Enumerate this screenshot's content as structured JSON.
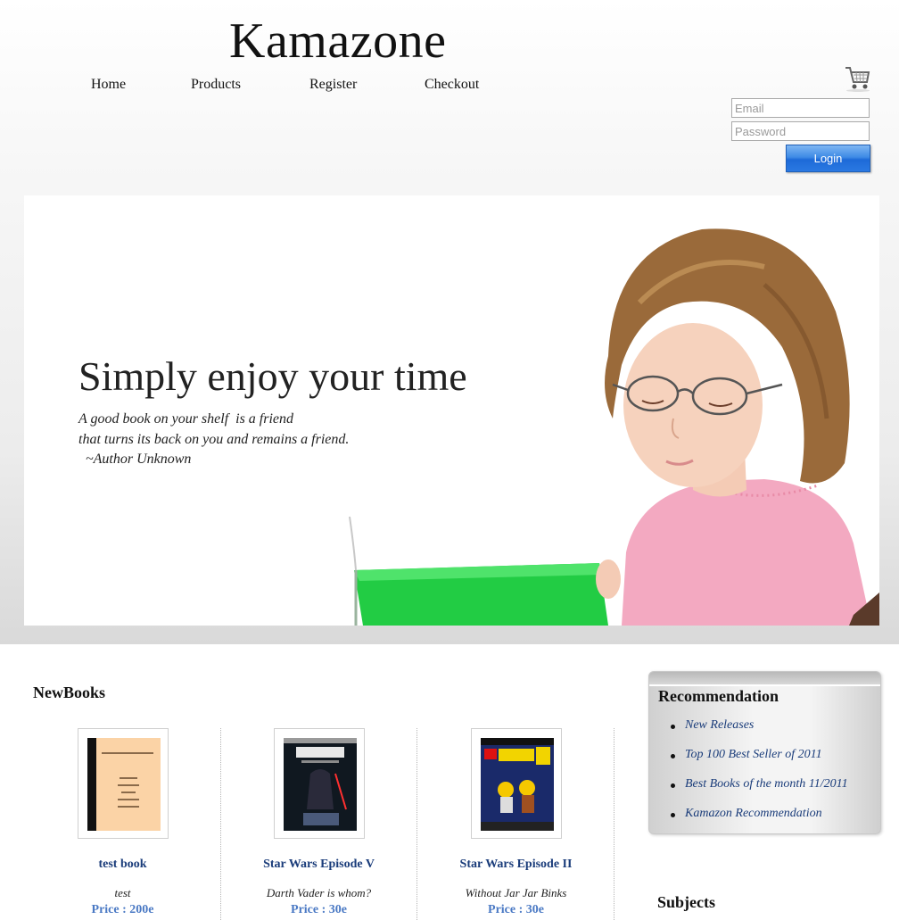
{
  "site": {
    "logo": "Kamazone"
  },
  "nav": {
    "items": [
      "Home",
      "Products",
      "Register",
      "Checkout"
    ]
  },
  "login": {
    "email_placeholder": "Email",
    "password_placeholder": "Password",
    "button_label": "Login"
  },
  "hero": {
    "title": "Simply enjoy your time",
    "quote_line1": "A good book on your shelf  is a friend",
    "quote_line2": "that turns its back on you and remains a friend.",
    "quote_author": "  ~Author Unknown"
  },
  "new_books": {
    "title": "NewBooks",
    "items": [
      {
        "name": "test book",
        "desc": "test",
        "price": "Price : 200e"
      },
      {
        "name": "Star Wars Episode V",
        "desc": "Darth Vader is whom?",
        "price": "Price : 30e"
      },
      {
        "name": "Star Wars Episode II",
        "desc": "Without Jar Jar Binks",
        "price": "Price : 30e"
      }
    ]
  },
  "recommendation": {
    "title": "Recommendation",
    "items": [
      "New Releases",
      "Top 100 Best Seller of 2011",
      "Best Books of the month 11/2011",
      "Kamazon Recommendation"
    ]
  },
  "subjects": {
    "title": "Subjects"
  },
  "colors": {
    "link": "#1a3c7a",
    "price": "#4a79c4",
    "login_button": "#2a79e2",
    "book_cover_green": "#22cc44"
  }
}
